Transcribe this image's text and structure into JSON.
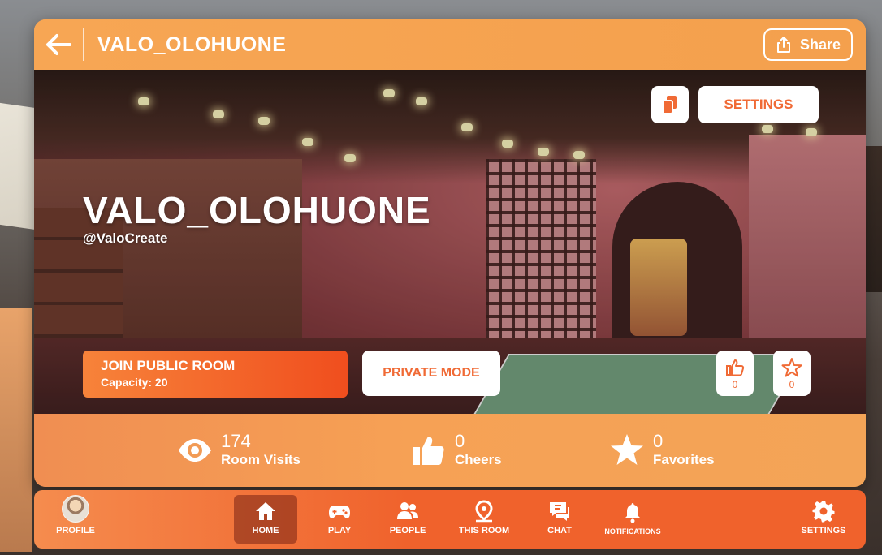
{
  "header": {
    "back_icon": "arrow-left-icon",
    "title": "VALO_OLOHUONE",
    "share_label": "Share",
    "share_icon": "share-icon"
  },
  "hero": {
    "room_name": "VALO_OLOHUONE",
    "creator": "@ValoCreate",
    "copy_icon": "copy-icon",
    "settings_label": "SETTINGS",
    "join": {
      "label": "JOIN PUBLIC ROOM",
      "capacity": "Capacity: 20"
    },
    "private_label": "PRIVATE MODE",
    "cheer_count": "0",
    "favorite_count": "0"
  },
  "stats": {
    "visits": {
      "value": "174",
      "label": "Room Visits",
      "icon": "eye-icon"
    },
    "cheers": {
      "value": "0",
      "label": "Cheers",
      "icon": "thumbs-up-icon"
    },
    "favorites": {
      "value": "0",
      "label": "Favorites",
      "icon": "star-icon"
    }
  },
  "nav": {
    "items": [
      {
        "label": "PROFILE",
        "icon": "avatar"
      },
      {
        "label": "HOME",
        "icon": "home-icon",
        "active": true
      },
      {
        "label": "PLAY",
        "icon": "gamepad-icon"
      },
      {
        "label": "PEOPLE",
        "icon": "people-icon"
      },
      {
        "label": "THIS ROOM",
        "icon": "location-pin-icon"
      },
      {
        "label": "CHAT",
        "icon": "chat-icon"
      },
      {
        "label": "NOTIFICATIONS",
        "icon": "bell-icon"
      },
      {
        "label": "SETTINGS",
        "icon": "gear-icon"
      }
    ]
  },
  "colors": {
    "accent": "#f06a35",
    "header_orange": "#f4a04d",
    "nav_orange": "#f0622c"
  }
}
